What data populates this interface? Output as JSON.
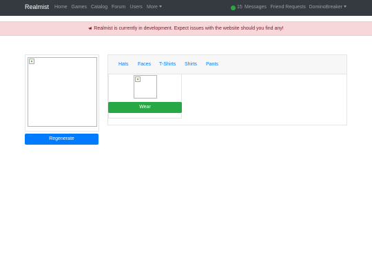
{
  "navbar": {
    "brand": "Realmist",
    "links": [
      "Home",
      "Games",
      "Catalog",
      "Forum",
      "Users"
    ],
    "more": "More",
    "currency_icon": "coin-icon",
    "currency_amount": "15",
    "messages": "Messages",
    "friend_requests": "Friend Requests",
    "username": "DominoBreaker"
  },
  "alert": {
    "icon": "megaphone-icon",
    "text": "Realmist is currently in development. Expect issues with the website should you find any!"
  },
  "avatar": {
    "regenerate_label": "Regenerate"
  },
  "inventory": {
    "tabs": [
      "Hats",
      "Faces",
      "T-Shirts",
      "Shirts",
      "Pants"
    ],
    "items": [
      {
        "wear_label": "Wear"
      }
    ]
  },
  "colors": {
    "navbar_bg": "#343a40",
    "alert_bg": "#f8d7da",
    "alert_text": "#721c24",
    "primary": "#007bff",
    "success": "#28a745"
  }
}
